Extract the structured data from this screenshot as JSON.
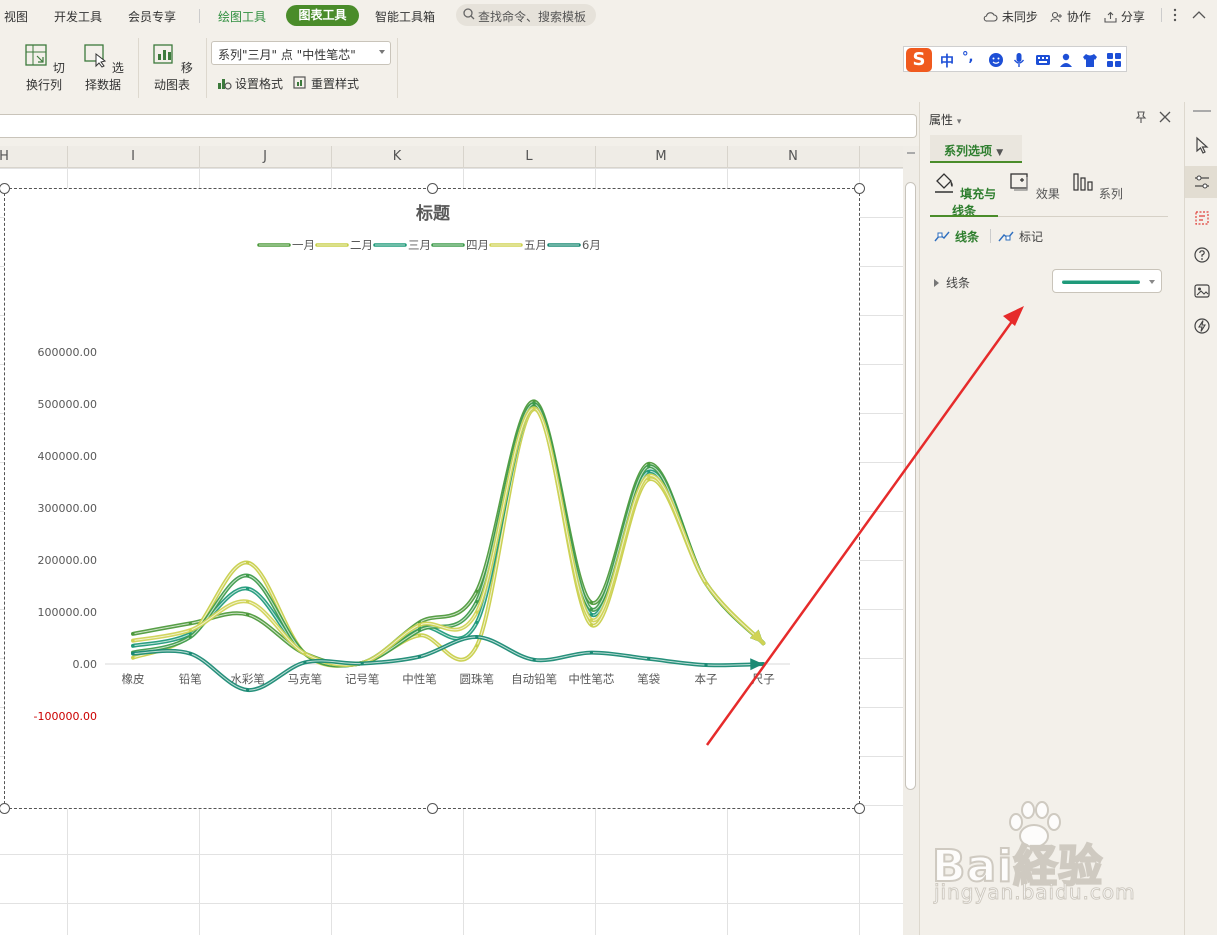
{
  "menu": {
    "view": "视图",
    "dev_tools": "开发工具",
    "member": "会员专享",
    "draw_tools": "绘图工具",
    "chart_tools": "图表工具",
    "smart_toolbox": "智能工具箱",
    "search_placeholder": "查找命令、搜索模板",
    "unsynced": "未同步",
    "collaborate": "协作",
    "share": "分享"
  },
  "ribbon": {
    "switch_row_col": "切换行列",
    "select_data": "选择数据",
    "move_chart": "移动图表",
    "series_selector": "系列\"三月\" 点 \"中性笔芯\"",
    "set_format": "设置格式",
    "reset_style": "重置样式"
  },
  "ime": {
    "lang": "中",
    "punct": "°,"
  },
  "columns": [
    "H",
    "I",
    "J",
    "K",
    "L",
    "M",
    "N"
  ],
  "chart_data": {
    "type": "line",
    "title": "标题",
    "smooth": true,
    "categories": [
      "橡皮",
      "铅笔",
      "水彩笔",
      "马克笔",
      "记号笔",
      "中性笔",
      "圆珠笔",
      "自动铅笔",
      "中性笔芯",
      "笔袋",
      "本子",
      "尺子"
    ],
    "y_ticks": [
      "600000.00",
      "500000.00",
      "400000.00",
      "300000.00",
      "200000.00",
      "100000.00",
      "0.00",
      "-100000.00"
    ],
    "ylim": [
      -100000,
      600000
    ],
    "legend_position": "top",
    "colors": {
      "negative_tick": "#cc0000"
    },
    "series": [
      {
        "name": "一月",
        "color": "#4e9a3c",
        "values": [
          58000,
          78000,
          95000,
          20000,
          2000,
          80000,
          140000,
          505000,
          118000,
          385000,
          155000,
          40000
        ]
      },
      {
        "name": "二月",
        "color": "#c8cf4a",
        "values": [
          12000,
          55000,
          195000,
          20000,
          2000,
          55000,
          35000,
          490000,
          75000,
          355000,
          155000,
          40000
        ]
      },
      {
        "name": "三月",
        "color": "#1f9a7a",
        "values": [
          35000,
          58000,
          145000,
          20000,
          2000,
          70000,
          80000,
          495000,
          95000,
          370000,
          155000,
          40000
        ]
      },
      {
        "name": "四月",
        "color": "#3e9b4c",
        "values": [
          22000,
          52000,
          170000,
          20000,
          2000,
          65000,
          120000,
          500000,
          105000,
          380000,
          155000,
          40000
        ]
      },
      {
        "name": "五月",
        "color": "#d0d355",
        "values": [
          45000,
          65000,
          120000,
          20000,
          2000,
          75000,
          100000,
          492000,
          85000,
          362000,
          155000,
          40000
        ]
      },
      {
        "name": "6月",
        "color": "#1a8a74",
        "values": [
          20000,
          20000,
          -50000,
          3000,
          1000,
          14000,
          52000,
          8000,
          22000,
          10000,
          -2000,
          0
        ]
      }
    ]
  },
  "pane": {
    "title": "属性",
    "series_options": "系列选项",
    "tab_fill_line": "填充与线条",
    "tab_effect": "效果",
    "tab_series": "系列",
    "sub_line": "线条",
    "sub_marker": "标记",
    "line_row": "线条"
  },
  "watermark": {
    "brand": "Bai経验",
    "url": "jingyan.baidu.com"
  }
}
